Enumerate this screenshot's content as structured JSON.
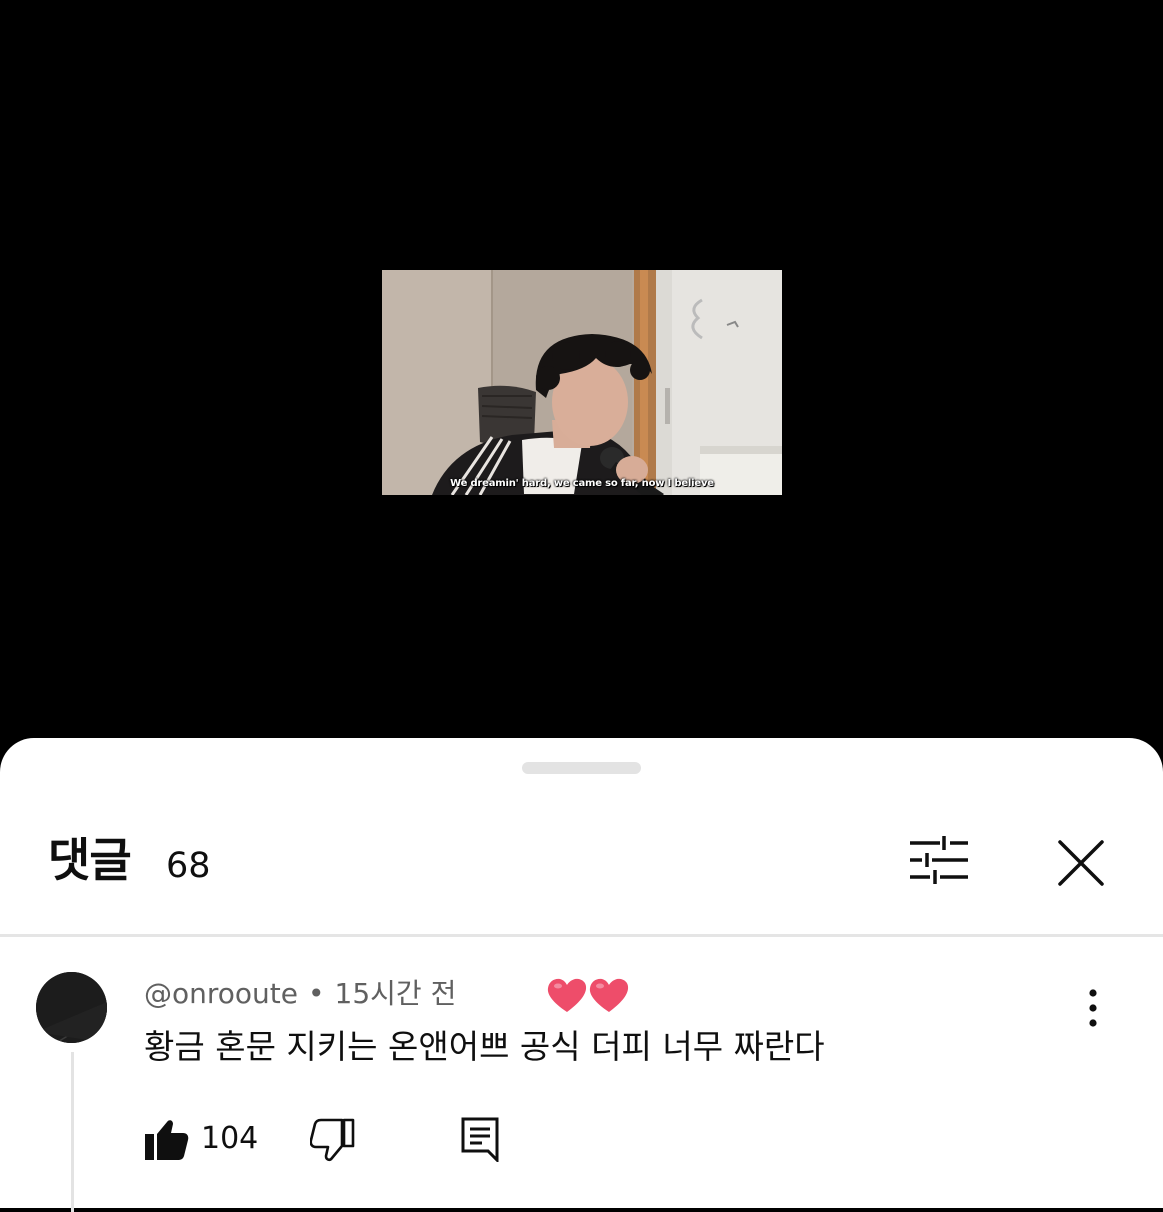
{
  "video": {
    "subtitle": "We dreamin' hard, we came so far, now I believe"
  },
  "comments_panel": {
    "title": "댓글",
    "count": "68",
    "filter_icon": "sort-filter-icon",
    "close_icon": "close-icon"
  },
  "comments": [
    {
      "author": "@onrooute",
      "separator": "•",
      "time": "15시간 전",
      "text": "황금 혼문 지키는 온앤어쁘 공식 더피 너무 짜란다",
      "likes": "104",
      "reaction_icon": "hearts-icon",
      "colors": {
        "heart": "#ee4d6a"
      }
    }
  ]
}
